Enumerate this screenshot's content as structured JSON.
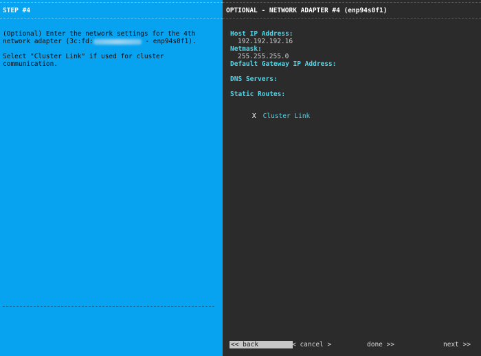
{
  "left": {
    "title": "STEP #4",
    "desc_line1": "(Optional) Enter the network settings for the 4th",
    "desc_line2_prefix": "network adapter (3c:fd:",
    "desc_line2_suffix": " - enp94s0f1).",
    "desc_line3": "Select \"Cluster Link\" if used for cluster",
    "desc_line4": "communication."
  },
  "right": {
    "title": "OPTIONAL - NETWORK ADAPTER #4 (enp94s0f1)",
    "host_ip_label": "Host IP Address:",
    "host_ip_value": "192.192.192.16",
    "netmask_label": "Netmask:",
    "netmask_value": "255.255.255.0",
    "gateway_label": "Default Gateway IP Address:",
    "dns_label": "DNS Servers:",
    "routes_label": "Static Routes:",
    "cluster_link_mark": "X",
    "cluster_link_label": "Cluster Link"
  },
  "nav": {
    "back": "<< back",
    "cancel": "< cancel >",
    "done": "done >>",
    "next": "next >>"
  }
}
